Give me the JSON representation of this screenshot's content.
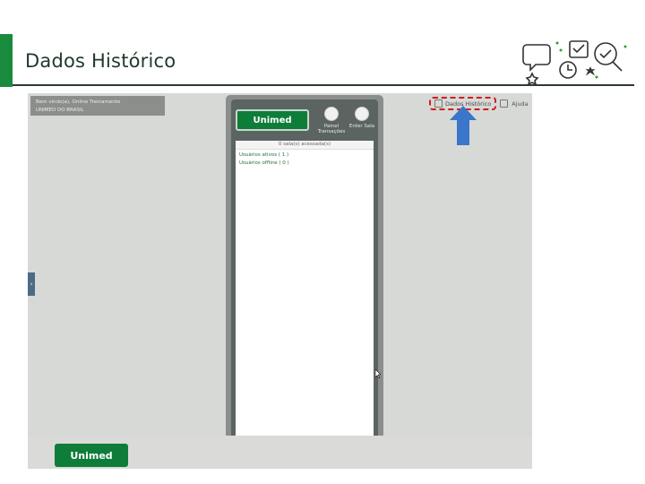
{
  "header": {
    "title": "Dados Histórico"
  },
  "welcome": {
    "line1": "Bem vindo(a), Online Treinamento",
    "line2": "UNIMED DO BRASIL"
  },
  "side_tab": {
    "glyph": "›"
  },
  "toplinks": {
    "history_label": "Dados Histórico",
    "help_label": "Ajuda"
  },
  "panel": {
    "logo_text": "Unimed",
    "btn_transacoes": "Painel Transações",
    "btn_sala": "Enter Sala",
    "status_header": "0 sala(s) acessada(s)",
    "users_active": "Usuários ativos ( 1 )",
    "users_offline": "Usuários offline ( 0 )"
  },
  "footer": {
    "logo_text": "Unimed"
  },
  "colors": {
    "brand_green": "#0f7d3a",
    "highlight": "#d21c1c",
    "arrow": "#3a76c9"
  },
  "icons": [
    "arrow-up-icon",
    "history-icon",
    "help-icon",
    "transactions-icon",
    "room-icon",
    "decorative-icons-cluster"
  ]
}
